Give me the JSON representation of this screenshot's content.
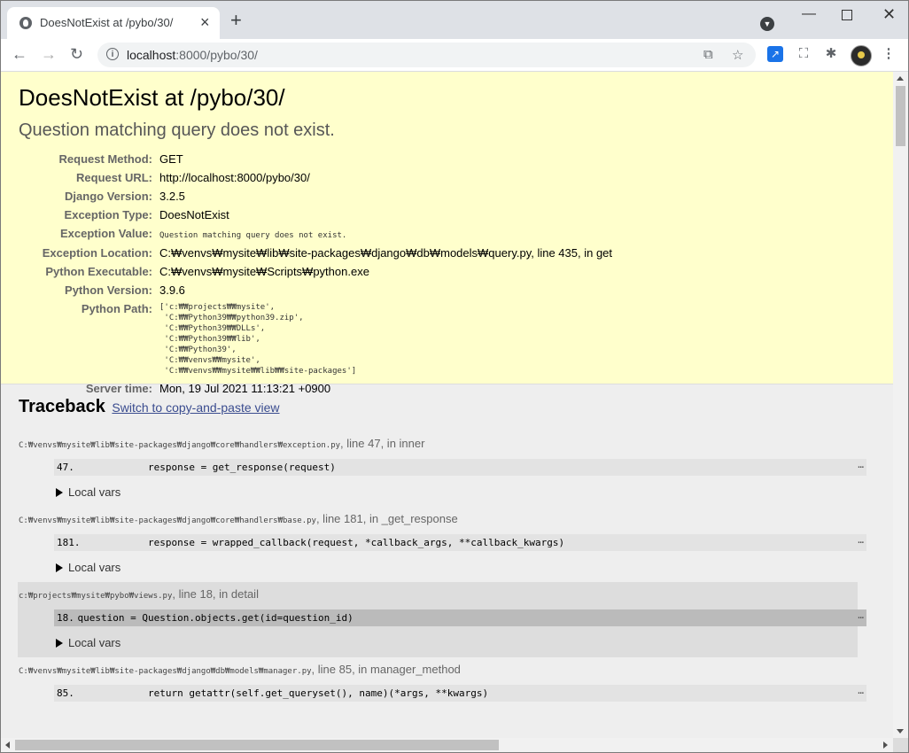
{
  "browser": {
    "tab_title": "DoesNotExist at /pybo/30/",
    "url_host": "localhost",
    "url_rest": ":8000/pybo/30/",
    "window_controls": [
      "minimize-icon",
      "maximize-icon",
      "close-icon"
    ]
  },
  "page": {
    "title": "DoesNotExist at /pybo/30/",
    "subtitle": "Question matching query does not exist.",
    "meta": [
      {
        "label": "Request Method:",
        "value": "GET"
      },
      {
        "label": "Request URL:",
        "value": "http://localhost:8000/pybo/30/"
      },
      {
        "label": "Django Version:",
        "value": "3.2.5"
      },
      {
        "label": "Exception Type:",
        "value": "DoesNotExist"
      },
      {
        "label": "Exception Value:",
        "value": "Question matching query does not exist."
      },
      {
        "label": "Exception Location:",
        "value": "C:₩venvs₩mysite₩lib₩site-packages₩django₩db₩models₩query.py, line 435, in get"
      },
      {
        "label": "Python Executable:",
        "value": "C:₩venvs₩mysite₩Scripts₩python.exe"
      },
      {
        "label": "Python Version:",
        "value": "3.9.6"
      },
      {
        "label": "Python Path:",
        "value": "['c:₩₩projects₩₩mysite',\n 'C:₩₩Python39₩₩python39.zip',\n 'C:₩₩Python39₩₩DLLs',\n 'C:₩₩Python39₩₩lib',\n 'C:₩₩Python39',\n 'C:₩₩venvs₩₩mysite',\n 'C:₩₩venvs₩₩mysite₩₩lib₩₩site-packages']"
      },
      {
        "label": "Server time:",
        "value": "Mon, 19 Jul 2021 11:13:21 +0900"
      }
    ]
  },
  "traceback": {
    "heading": "Traceback",
    "switch_link": "Switch to copy-and-paste view",
    "local_vars_label": "Local vars",
    "frames": [
      {
        "file": "C:₩venvs₩mysite₩lib₩site-packages₩django₩core₩handlers₩exception.py",
        "where": ", line 47, in inner",
        "line": "47.",
        "code": "                response = get_response(request)",
        "more": "…",
        "user": false
      },
      {
        "file": "C:₩venvs₩mysite₩lib₩site-packages₩django₩core₩handlers₩base.py",
        "where": ", line 181, in _get_response",
        "line": "181.",
        "code": "                response = wrapped_callback(request, *callback_args, **callback_kwargs)",
        "more": "…",
        "user": false
      },
      {
        "file": "c:₩projects₩mysite₩pybo₩views.py",
        "where": ", line 18, in detail",
        "line": "18.",
        "code": "    question = Question.objects.get(id=question_id)",
        "more": "…",
        "user": true
      },
      {
        "file": "C:₩venvs₩mysite₩lib₩site-packages₩django₩db₩models₩manager.py",
        "where": ", line 85, in manager_method",
        "line": "85.",
        "code": "                return getattr(self.get_queryset(), name)(*args, **kwargs)",
        "more": "…",
        "user": false
      }
    ]
  }
}
